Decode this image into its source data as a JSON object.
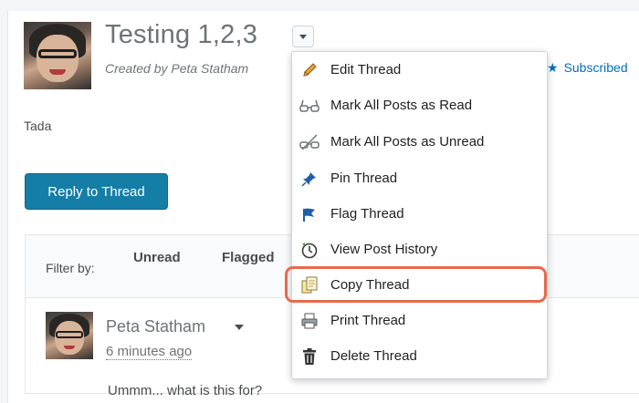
{
  "thread": {
    "title": "Testing 1,2,3",
    "created_by": "Created by Peta Statham",
    "subscribed_label": "Subscribed",
    "body": "Tada"
  },
  "actions": {
    "reply_label": "Reply to Thread"
  },
  "filter": {
    "label": "Filter by:",
    "options": [
      "Unread",
      "Flagged"
    ]
  },
  "post": {
    "author": "Peta Statham",
    "time": "6 minutes ago",
    "body": "Ummm... what is this for?"
  },
  "menu": {
    "items": [
      {
        "label": "Edit Thread",
        "icon": "pencil-icon"
      },
      {
        "label": "Mark All Posts as Read",
        "icon": "glasses-icon"
      },
      {
        "label": "Mark All Posts as Unread",
        "icon": "glasses-crossed-icon"
      },
      {
        "label": "Pin Thread",
        "icon": "pin-icon"
      },
      {
        "label": "Flag Thread",
        "icon": "flag-icon"
      },
      {
        "label": "View Post History",
        "icon": "history-clock-icon"
      },
      {
        "label": "Copy Thread",
        "icon": "copy-icon",
        "highlighted": true
      },
      {
        "label": "Print Thread",
        "icon": "printer-icon"
      },
      {
        "label": "Delete Thread",
        "icon": "trash-icon"
      }
    ]
  },
  "colors": {
    "primary_button": "#157ea7",
    "link": "#006fbf",
    "highlight": "#e8694b"
  }
}
